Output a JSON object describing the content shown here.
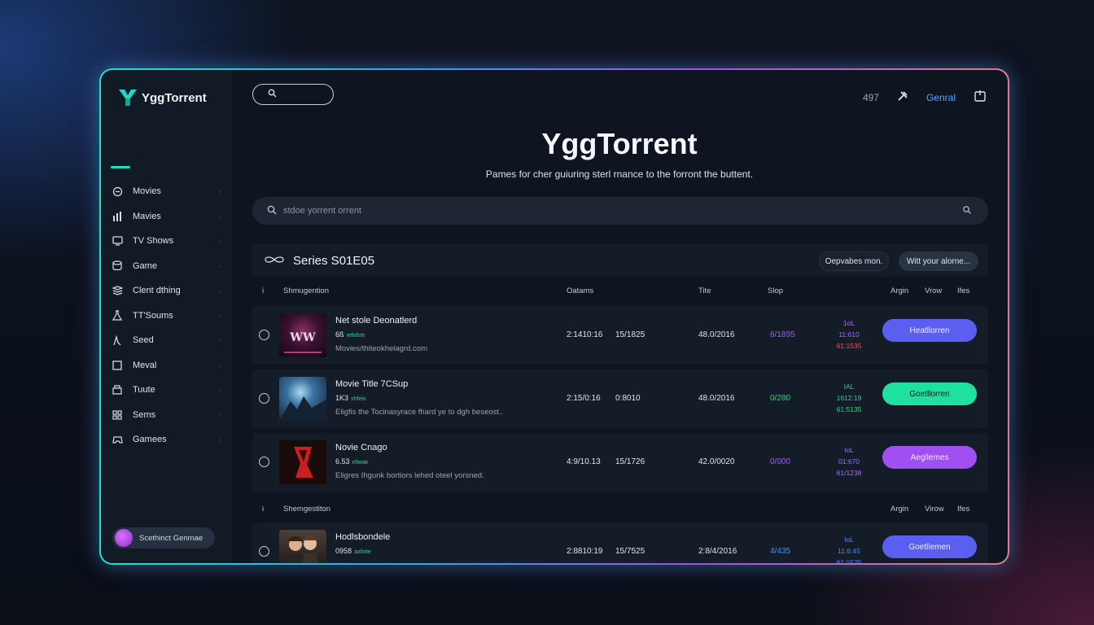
{
  "app": {
    "logo_text": "YggTorrent"
  },
  "sidebar": {
    "items": [
      {
        "label": "Movies",
        "icon": "clapper-icon"
      },
      {
        "label": "Mavies",
        "icon": "bar-chart-icon"
      },
      {
        "label": "TV Shows",
        "icon": "tv-icon"
      },
      {
        "label": "Game",
        "icon": "database-icon"
      },
      {
        "label": "Clent dthing",
        "icon": "layers-icon"
      },
      {
        "label": "TT'Soums",
        "icon": "flask-icon"
      },
      {
        "label": "Seed",
        "icon": "trend-icon"
      },
      {
        "label": "Meval",
        "icon": "square-icon"
      },
      {
        "label": "Tuute",
        "icon": "box-icon"
      },
      {
        "label": "Sems",
        "icon": "grid-icon"
      },
      {
        "label": "Gamees",
        "icon": "gamepad-icon"
      }
    ],
    "user": {
      "name": "Scethinct Genmae"
    }
  },
  "header": {
    "search_icon": "search-icon",
    "count": "497",
    "general": "Genral"
  },
  "hero": {
    "title": "YggTorrent",
    "subtitle": "Pames for cher guiuring sterl rnance to the forront the buttent."
  },
  "search": {
    "placeholder": "stdoe yorrent orrent"
  },
  "panel": {
    "title": "Series S01E05",
    "btn_a": "Oepvabes mon.",
    "btn_b": "Witt your alorne..."
  },
  "columns": {
    "first": "Shmugention",
    "second": "Oatams",
    "third": "Tite",
    "fourth": "Slop",
    "a": "Argin",
    "b": "Vrow",
    "c": "Ifes"
  },
  "columns2": {
    "first": "Shemgestiton",
    "a": "Argin",
    "b": "Virow",
    "c": "Ifes"
  },
  "rows": [
    {
      "title": "Net stole Deonatlerd",
      "size": "6ß",
      "size_tag": "refolste",
      "desc": "Movies/thiteokhelagrd.com",
      "c1": "2:1410:16",
      "c2": "15/1825",
      "c3": "48.0/2016",
      "c4": "6/1895",
      "stat1": "1oL",
      "stat2": "11:610",
      "stat3": "61:1535",
      "btn": "Heatllorren",
      "btn_color": "#5a5ff0",
      "c4_color": "#9a60f0",
      "stat_color": "#a070ff",
      "stat3_color": "#f05050",
      "tag_color": "#30d080"
    },
    {
      "title": "Movie Title 7CSup",
      "size": "1K3",
      "size_tag": "shfeis",
      "desc": "Eligfis the Tocinasyrace fhard ye to dgh beseost..",
      "c1": "2:15/0:16",
      "c2": "0:8010",
      "c3": "48.0/2016",
      "c4": "0/280",
      "stat1": "IAL",
      "stat2": "1612:19",
      "stat3": "61:5135",
      "btn": "Goetllorren",
      "btn_color": "#20e0a0",
      "c4_color": "#30d080",
      "stat_color": "#30d080",
      "stat3_color": "#30d080",
      "tag_color": "#30d080"
    },
    {
      "title": "Novie Cnago",
      "size": "6.53",
      "size_tag": "eltwak",
      "desc": "Eligres Ihgunk bortiors lehed oteel yorsned.",
      "c1": "4:9/10.13",
      "c2": "15/1726",
      "c3": "42.0/0020",
      "c4": "0/000",
      "stat1": "IoL",
      "stat2": "01:670",
      "stat3": "61/1238",
      "btn": "Aegllemes",
      "btn_color": "#a050f0",
      "c4_color": "#9a60f0",
      "stat_color": "#a070ff",
      "stat3_color": "#a070ff",
      "tag_color": "#30d080"
    },
    {
      "title": "Hodlsbondele",
      "size": "0958",
      "size_tag": "aafxite",
      "desc": "",
      "c1": "2:8810:19",
      "c2": "15/7525",
      "c3": "2:8/4/2016",
      "c4": "4/435",
      "stat1": "IoL",
      "stat2": "11:6:45",
      "stat3": "61:1525",
      "btn": "Goetllemen",
      "btn_color": "#5a5ff0",
      "c4_color": "#4a8cf0",
      "stat_color": "#4a8cf0",
      "stat3_color": "#4a8cf0",
      "tag_color": "#30d080"
    }
  ],
  "colors": {
    "accent": "#20e0c0",
    "link": "#4aa8ff"
  }
}
